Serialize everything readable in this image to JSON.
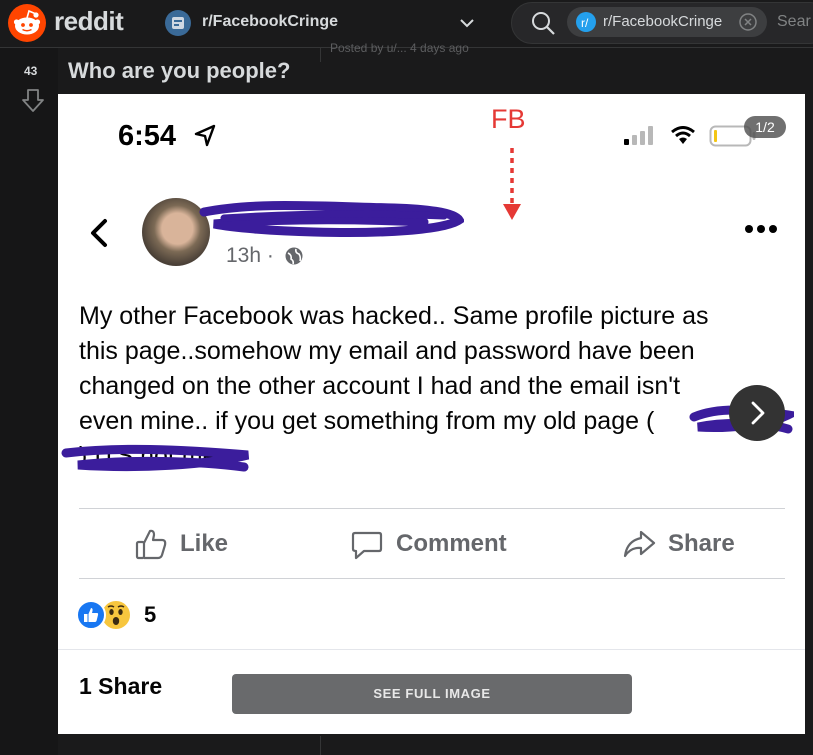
{
  "header": {
    "brand": "reddit",
    "subreddit": "r/FacebookCringe",
    "search": {
      "chip_label": "r/FacebookCringe",
      "placeholder": "Sear"
    }
  },
  "post": {
    "vote_count": "43",
    "title": "Who are you people?",
    "faded_meta": "Posted by u/... 4 days ago"
  },
  "image": {
    "status_time": "6:54",
    "annotation": "FB",
    "gallery_counter": "1/2",
    "fb_post": {
      "time": "13h ·",
      "body": "My other Facebook was hacked.. Same profile picture as\nthis page..somehow my email and password have been\nchanged on the other account I had and the email isn't\neven mine.. if you get something from my old page (\n) ITS not me",
      "actions": {
        "like": "Like",
        "comment": "Comment",
        "share": "Share"
      },
      "reaction_count": "5",
      "shares": "1 Share"
    },
    "see_full_image": "SEE FULL IMAGE"
  },
  "colors": {
    "reddit_orange": "#ff4500",
    "header_bg": "#1a1a1b",
    "facebook_blue": "#1877f2",
    "annotation_red": "#e53935",
    "scribble_purple": "#3b1d9c"
  },
  "icons": [
    "reddit-logo-icon",
    "subreddit-icon",
    "chevron-down-icon",
    "search-icon",
    "close-icon",
    "downvote-icon",
    "location-arrow-icon",
    "signal-icon",
    "wifi-icon",
    "battery-icon",
    "back-icon",
    "globe-icon",
    "more-icon",
    "next-icon",
    "like-icon",
    "comment-icon",
    "share-icon",
    "like-reaction-icon",
    "wow-reaction-icon"
  ]
}
